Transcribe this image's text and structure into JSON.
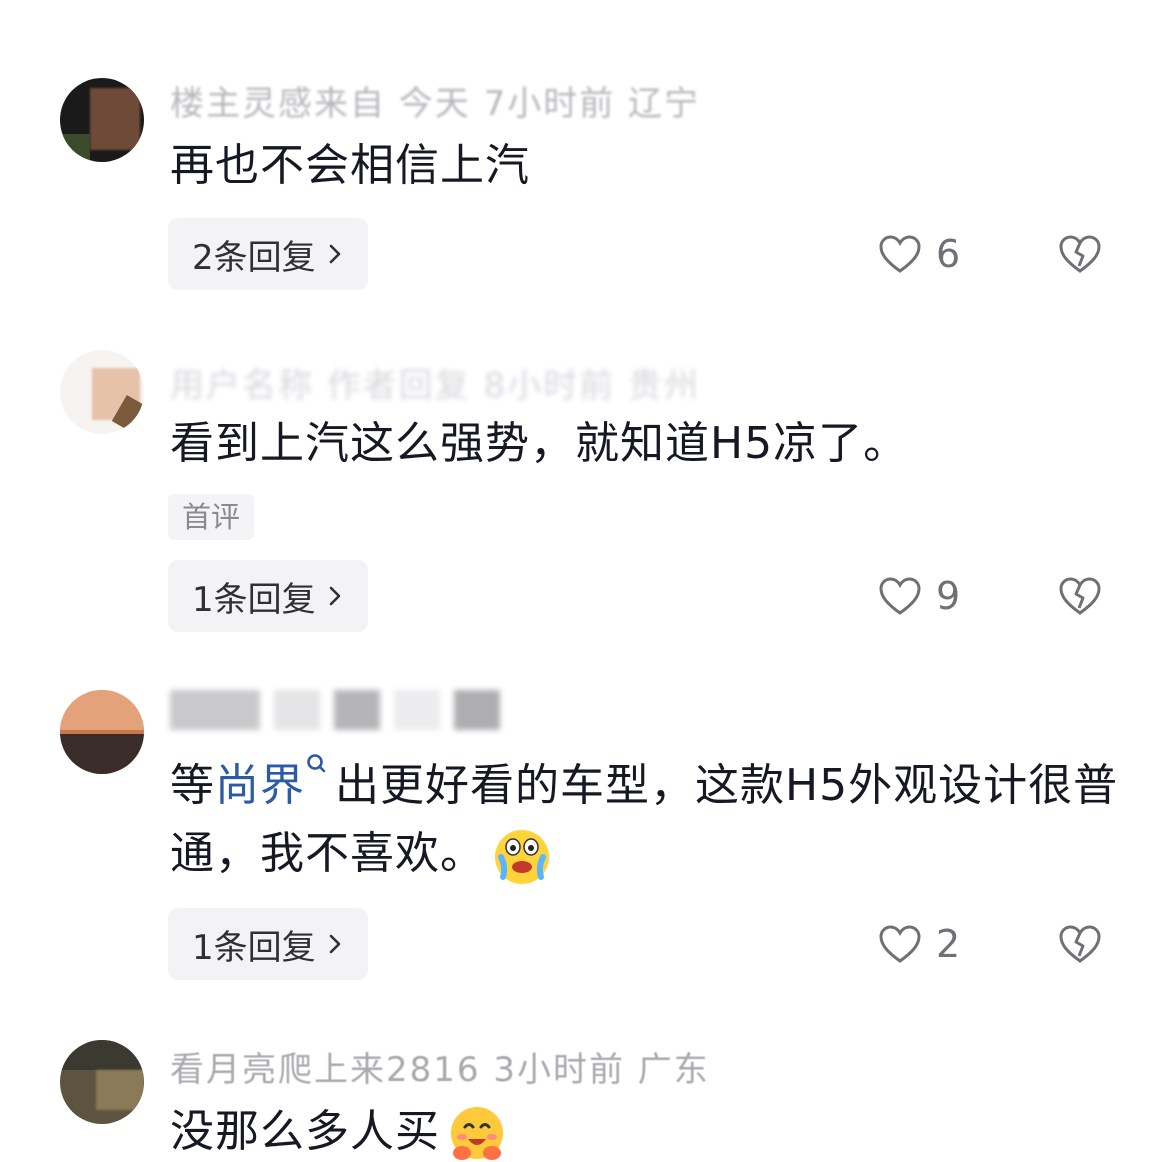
{
  "comments": [
    {
      "meta": "楼主灵感来自 今天 7小时前 辽宁",
      "text": "再也不会相信上汽",
      "replies": "2条回复",
      "likes": "6"
    },
    {
      "meta": "用户名称 作者回复 8小时前 贵州",
      "text": "看到上汽这么强势，就知道H5凉了。",
      "tag": "首评",
      "replies": "1条回复",
      "likes": "9"
    },
    {
      "meta": "",
      "text_before": "等",
      "text_link": "尚界",
      "text_after": "出更好看的车型，这款H5外观设计很普通，我不喜欢。",
      "emoji": "crying-face-emoji",
      "replies": "1条回复",
      "likes": "2"
    },
    {
      "meta": "看月亮爬上来2816 3小时前 广东",
      "text": "没那么多人买",
      "emoji": "hugging-face-emoji"
    }
  ],
  "icons": {
    "like": "heart-outline-icon",
    "dislike": "broken-heart-icon",
    "chevron": "chevron-right-icon",
    "search": "search-icon"
  },
  "colors": {
    "text": "#161823",
    "link": "#2d5aa6",
    "muted": "#6f7076",
    "button_bg": "#f3f3f5"
  }
}
